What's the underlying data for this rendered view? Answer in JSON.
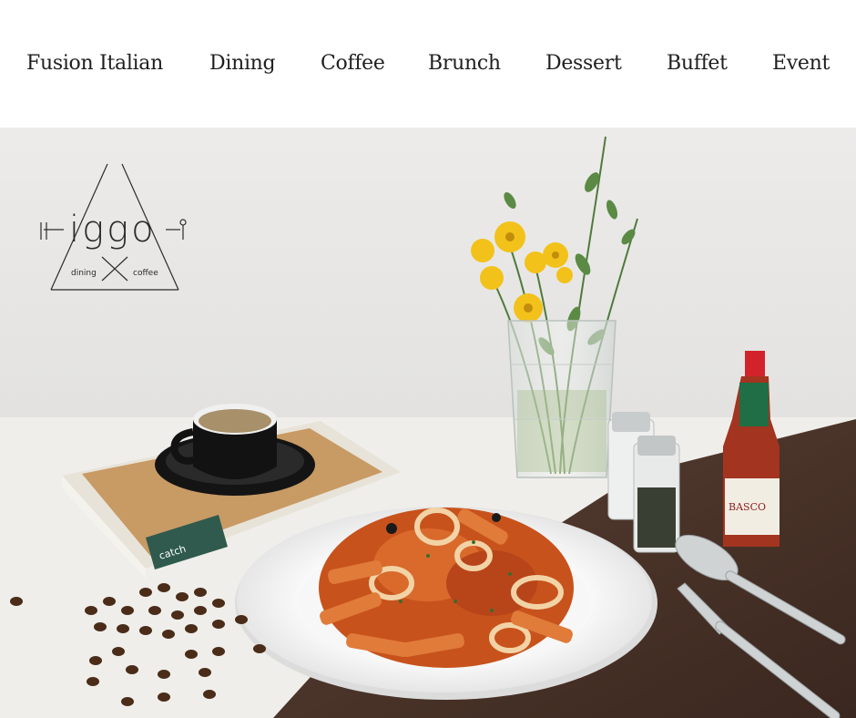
{
  "nav": {
    "items": [
      {
        "label": "Fusion Italian"
      },
      {
        "label": "Dining"
      },
      {
        "label": "Coffee"
      },
      {
        "label": "Brunch"
      },
      {
        "label": "Dessert"
      },
      {
        "label": "Buffet"
      },
      {
        "label": "Event"
      }
    ]
  },
  "hero": {
    "logo": {
      "wordmark": "iggo",
      "left_word": "dining",
      "right_word": "coffee"
    },
    "book_label": "catch",
    "bottle_label": "BASCO"
  },
  "colors": {
    "wall": "#e9e8e6",
    "tablecloth": "#efeeea",
    "wood": "#4a3328",
    "sauce": "#c8521c",
    "flower": "#f2c21a",
    "bottle_cap": "#d2232a"
  }
}
